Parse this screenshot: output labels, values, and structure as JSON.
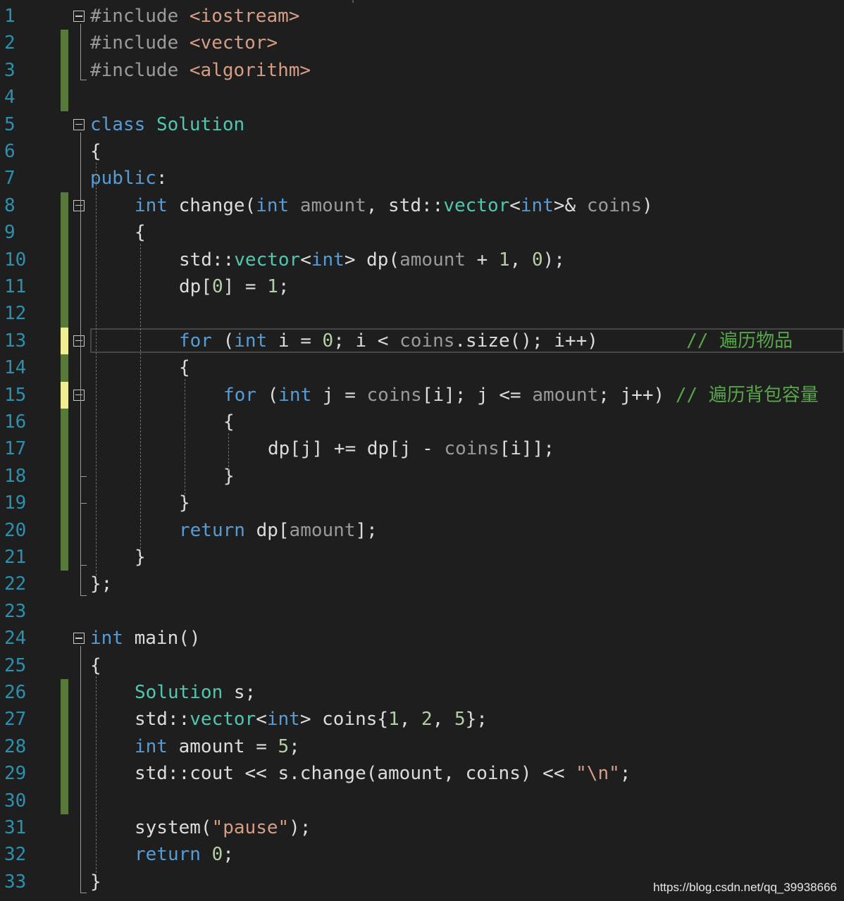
{
  "editor": {
    "theme_colors": {
      "background": "#1e1e1e",
      "line_number": "#2b91af",
      "keyword": "#569cd6",
      "type": "#4ec9b0",
      "string": "#d69d85",
      "number": "#b5cea8",
      "comment": "#57a64a",
      "preprocessor": "#9b9b9b",
      "parameter": "#9a9a9a",
      "plain": "#dcdcdc",
      "saved_change_marker": "#57793a",
      "unsaved_change_marker": "#efef91"
    },
    "lines": [
      {
        "n": "1",
        "change": "none",
        "fold": true,
        "indent": 0,
        "tokens": [
          [
            "#include ",
            "pp"
          ],
          [
            "<iostream>",
            "str"
          ]
        ]
      },
      {
        "n": "2",
        "change": "saved",
        "fold": false,
        "indent": 0,
        "tokens": [
          [
            "#include ",
            "pp"
          ],
          [
            "<vector>",
            "str"
          ]
        ]
      },
      {
        "n": "3",
        "change": "saved",
        "fold": false,
        "indent": 0,
        "tokens": [
          [
            "#include ",
            "pp"
          ],
          [
            "<algorithm>",
            "str"
          ]
        ]
      },
      {
        "n": "4",
        "change": "saved",
        "fold": false,
        "indent": 0,
        "tokens": []
      },
      {
        "n": "5",
        "change": "none",
        "fold": true,
        "indent": 0,
        "tokens": [
          [
            "class",
            "kw"
          ],
          [
            " ",
            "plain"
          ],
          [
            "Solution",
            "type"
          ]
        ]
      },
      {
        "n": "6",
        "change": "none",
        "fold": false,
        "indent": 0,
        "tokens": [
          [
            "{",
            "plain"
          ]
        ]
      },
      {
        "n": "7",
        "change": "none",
        "fold": false,
        "indent": 0,
        "tokens": [
          [
            "public",
            "kw"
          ],
          [
            ":",
            "plain"
          ]
        ]
      },
      {
        "n": "8",
        "change": "saved",
        "fold": true,
        "indent": 1,
        "tokens": [
          [
            "int",
            "kw"
          ],
          [
            " change(",
            "plain"
          ],
          [
            "int",
            "kw"
          ],
          [
            " ",
            "plain"
          ],
          [
            "amount",
            "param"
          ],
          [
            ", std::",
            "plain"
          ],
          [
            "vector",
            "type"
          ],
          [
            "<",
            "plain"
          ],
          [
            "int",
            "kw"
          ],
          [
            ">& ",
            "plain"
          ],
          [
            "coins",
            "param"
          ],
          [
            ")",
            "plain"
          ]
        ]
      },
      {
        "n": "9",
        "change": "saved",
        "fold": false,
        "indent": 1,
        "tokens": [
          [
            "{",
            "plain"
          ]
        ]
      },
      {
        "n": "10",
        "change": "saved",
        "fold": false,
        "indent": 2,
        "tokens": [
          [
            "std::",
            "plain"
          ],
          [
            "vector",
            "type"
          ],
          [
            "<",
            "plain"
          ],
          [
            "int",
            "kw"
          ],
          [
            "> dp(",
            "plain"
          ],
          [
            "amount",
            "param"
          ],
          [
            " + ",
            "plain"
          ],
          [
            "1",
            "num"
          ],
          [
            ", ",
            "plain"
          ],
          [
            "0",
            "num"
          ],
          [
            ");",
            "plain"
          ]
        ]
      },
      {
        "n": "11",
        "change": "saved",
        "fold": false,
        "indent": 2,
        "tokens": [
          [
            "dp[",
            "plain"
          ],
          [
            "0",
            "num"
          ],
          [
            "] = ",
            "plain"
          ],
          [
            "1",
            "num"
          ],
          [
            ";",
            "plain"
          ]
        ]
      },
      {
        "n": "12",
        "change": "saved",
        "fold": false,
        "indent": 2,
        "tokens": []
      },
      {
        "n": "13",
        "change": "unsaved",
        "fold": true,
        "indent": 2,
        "current": true,
        "tokens": [
          [
            "for",
            "kw"
          ],
          [
            " (",
            "plain"
          ],
          [
            "int",
            "kw"
          ],
          [
            " i = ",
            "plain"
          ],
          [
            "0",
            "num"
          ],
          [
            "; i < ",
            "plain"
          ],
          [
            "coins",
            "param"
          ],
          [
            ".size(); i++)        ",
            "plain"
          ],
          [
            "// 遍历物品",
            "cmt"
          ]
        ]
      },
      {
        "n": "14",
        "change": "saved",
        "fold": false,
        "indent": 2,
        "tokens": [
          [
            "{",
            "plain"
          ]
        ]
      },
      {
        "n": "15",
        "change": "unsaved",
        "fold": true,
        "indent": 3,
        "tokens": [
          [
            "for",
            "kw"
          ],
          [
            " (",
            "plain"
          ],
          [
            "int",
            "kw"
          ],
          [
            " j = ",
            "plain"
          ],
          [
            "coins",
            "param"
          ],
          [
            "[i]; j <= ",
            "plain"
          ],
          [
            "amount",
            "param"
          ],
          [
            "; j++) ",
            "plain"
          ],
          [
            "// 遍历背包容量",
            "cmt"
          ]
        ]
      },
      {
        "n": "16",
        "change": "saved",
        "fold": false,
        "indent": 3,
        "tokens": [
          [
            "{",
            "plain"
          ]
        ]
      },
      {
        "n": "17",
        "change": "saved",
        "fold": false,
        "indent": 4,
        "tokens": [
          [
            "dp[j] += dp[j - ",
            "plain"
          ],
          [
            "coins",
            "param"
          ],
          [
            "[i]];",
            "plain"
          ]
        ]
      },
      {
        "n": "18",
        "change": "saved",
        "fold": false,
        "indent": 3,
        "tokens": [
          [
            "}",
            "plain"
          ]
        ]
      },
      {
        "n": "19",
        "change": "saved",
        "fold": false,
        "indent": 2,
        "tokens": [
          [
            "}",
            "plain"
          ]
        ]
      },
      {
        "n": "20",
        "change": "saved",
        "fold": false,
        "indent": 2,
        "tokens": [
          [
            "return",
            "kw"
          ],
          [
            " dp[",
            "plain"
          ],
          [
            "amount",
            "param"
          ],
          [
            "];",
            "plain"
          ]
        ]
      },
      {
        "n": "21",
        "change": "saved",
        "fold": false,
        "indent": 1,
        "tokens": [
          [
            "}",
            "plain"
          ]
        ]
      },
      {
        "n": "22",
        "change": "none",
        "fold": false,
        "indent": 0,
        "tokens": [
          [
            "};",
            "plain"
          ]
        ]
      },
      {
        "n": "23",
        "change": "none",
        "fold": false,
        "indent": 0,
        "tokens": []
      },
      {
        "n": "24",
        "change": "none",
        "fold": true,
        "indent": 0,
        "tokens": [
          [
            "int",
            "kw"
          ],
          [
            " main()",
            "plain"
          ]
        ]
      },
      {
        "n": "25",
        "change": "none",
        "fold": false,
        "indent": 0,
        "tokens": [
          [
            "{",
            "plain"
          ]
        ]
      },
      {
        "n": "26",
        "change": "saved",
        "fold": false,
        "indent": 1,
        "tokens": [
          [
            "Solution",
            "type"
          ],
          [
            " s;",
            "plain"
          ]
        ]
      },
      {
        "n": "27",
        "change": "saved",
        "fold": false,
        "indent": 1,
        "tokens": [
          [
            "std::",
            "plain"
          ],
          [
            "vector",
            "type"
          ],
          [
            "<",
            "plain"
          ],
          [
            "int",
            "kw"
          ],
          [
            "> coins{",
            "plain"
          ],
          [
            "1",
            "num"
          ],
          [
            ", ",
            "plain"
          ],
          [
            "2",
            "num"
          ],
          [
            ", ",
            "plain"
          ],
          [
            "5",
            "num"
          ],
          [
            "};",
            "plain"
          ]
        ]
      },
      {
        "n": "28",
        "change": "saved",
        "fold": false,
        "indent": 1,
        "tokens": [
          [
            "int",
            "kw"
          ],
          [
            " amount = ",
            "plain"
          ],
          [
            "5",
            "num"
          ],
          [
            ";",
            "plain"
          ]
        ]
      },
      {
        "n": "29",
        "change": "saved",
        "fold": false,
        "indent": 1,
        "tokens": [
          [
            "std::cout << s.change(amount, coins) << ",
            "plain"
          ],
          [
            "\"\\n\"",
            "str"
          ],
          [
            ";",
            "plain"
          ]
        ]
      },
      {
        "n": "30",
        "change": "saved",
        "fold": false,
        "indent": 1,
        "tokens": []
      },
      {
        "n": "31",
        "change": "none",
        "fold": false,
        "indent": 1,
        "tokens": [
          [
            "system(",
            "plain"
          ],
          [
            "\"pause\"",
            "str"
          ],
          [
            ");",
            "plain"
          ]
        ]
      },
      {
        "n": "32",
        "change": "none",
        "fold": false,
        "indent": 1,
        "tokens": [
          [
            "return",
            "kw"
          ],
          [
            " ",
            "plain"
          ],
          [
            "0",
            "num"
          ],
          [
            ";",
            "plain"
          ]
        ]
      },
      {
        "n": "33",
        "change": "none",
        "fold": false,
        "indent": 0,
        "tokens": [
          [
            "}",
            "plain"
          ]
        ]
      }
    ]
  },
  "watermark": "https://blog.csdn.net/qq_39938666"
}
